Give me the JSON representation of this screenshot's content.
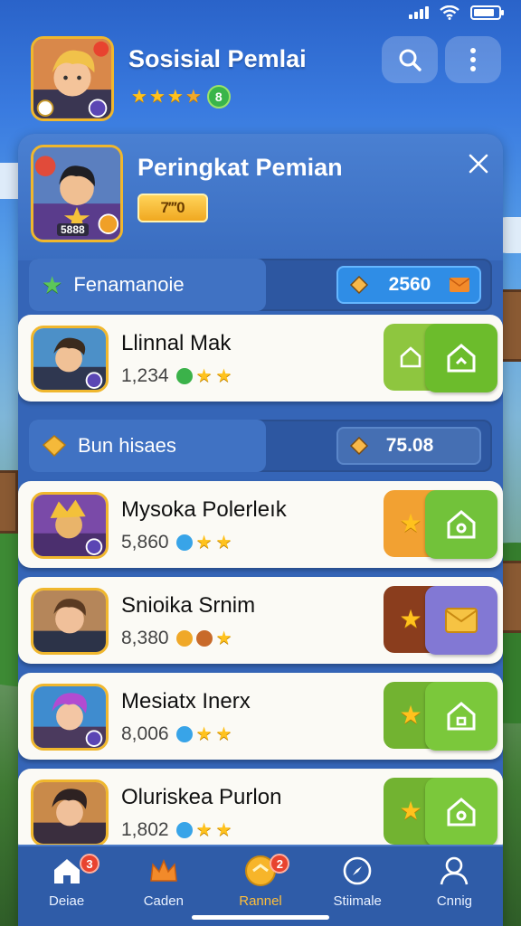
{
  "status_bar": {
    "icons": [
      "signal-icon",
      "wifi-icon",
      "battery-icon"
    ]
  },
  "header": {
    "title": "Sosisial Pemlai",
    "avatar_badge_top": "",
    "rating_badge": "8"
  },
  "panel": {
    "title": "Peringkat Pemian",
    "level": "7‴0",
    "avatar_caption": "5888"
  },
  "sections": [
    {
      "label": "Fenamanoie",
      "score": "2560",
      "icon": "star-icon"
    },
    {
      "label": "Bun hisaes",
      "score": "75.08",
      "icon": "diamond-icon"
    }
  ],
  "players": [
    {
      "name": "Llinnal Mak",
      "score": "1,234",
      "color": "#8ec63f",
      "color_b": "#6cbc2c",
      "icon_b": "house-icon"
    },
    {
      "name": "Mysoka Polerleık",
      "score": "5,860",
      "color": "#f2a132",
      "color_b": "#72c23a",
      "icon_b": "house-icon"
    },
    {
      "name": "Snioika Srnim",
      "score": "8,380",
      "color": "#8a3d1d",
      "color_b": "#8278d4",
      "icon_b": "envelope-icon"
    },
    {
      "name": "Mesiatx Inerx",
      "score": "8,006",
      "color": "#72b331",
      "color_b": "#7bc83b",
      "icon_b": "house-icon"
    },
    {
      "name": "Oluriskea Purlon",
      "score": "1,802",
      "color": "#72b331",
      "color_b": "#7bc83b",
      "icon_b": "house-icon"
    }
  ],
  "nav": [
    {
      "label": "Deiae",
      "badge": "3",
      "icon": "home-icon"
    },
    {
      "label": "Caden",
      "badge": "",
      "icon": "crown-icon"
    },
    {
      "label": "Rannel",
      "badge": "2",
      "icon": "coin-icon",
      "active": true
    },
    {
      "label": "Stiimale",
      "badge": "",
      "icon": "compass-icon"
    },
    {
      "label": "Cnnig",
      "badge": "",
      "icon": "profile-icon"
    }
  ],
  "colors": {
    "accent": "#ffc21d",
    "panel": "#3565b7",
    "nav": "#2f5ca8"
  }
}
